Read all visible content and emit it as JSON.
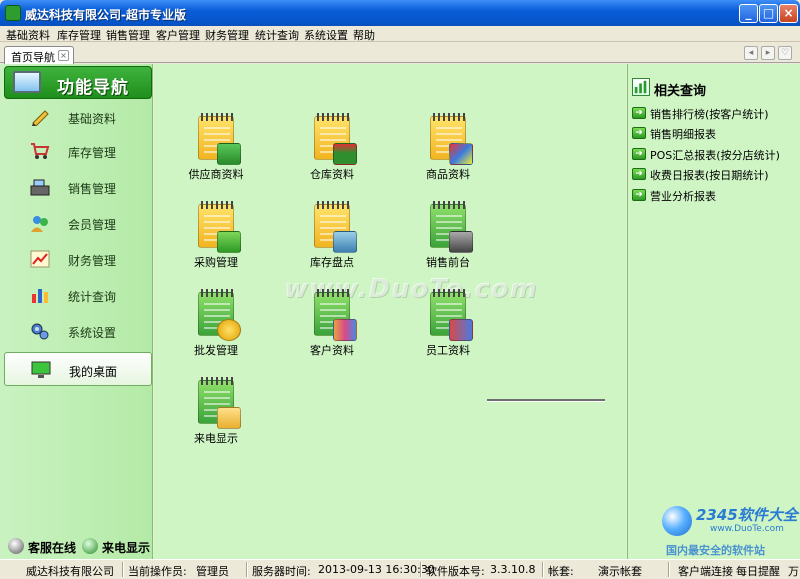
{
  "window": {
    "title": "威达科技有限公司-超市专业版"
  },
  "menu": [
    "基础资料",
    "库存管理",
    "销售管理",
    "客户管理",
    "财务管理",
    "统计查询",
    "系统设置",
    "帮助"
  ],
  "tab": {
    "label": "首页导航"
  },
  "sidebar": {
    "header": "功能导航",
    "items": [
      {
        "label": "基础资料",
        "icon": "pencil-icon"
      },
      {
        "label": "库存管理",
        "icon": "cart-icon"
      },
      {
        "label": "销售管理",
        "icon": "cash-register-icon"
      },
      {
        "label": "会员管理",
        "icon": "members-icon"
      },
      {
        "label": "财务管理",
        "icon": "chart-icon"
      },
      {
        "label": "统计查询",
        "icon": "statistics-icon"
      },
      {
        "label": "系统设置",
        "icon": "gears-icon"
      },
      {
        "label": "我的桌面",
        "icon": "desktop-icon"
      }
    ],
    "bottom": {
      "service": "客服在线",
      "caller": "来电显示"
    }
  },
  "tiles": [
    {
      "label": "供应商资料",
      "icon": "truck-icon"
    },
    {
      "label": "仓库资料",
      "icon": "warehouse-icon"
    },
    {
      "label": "商品资料",
      "icon": "goods-icon"
    },
    {
      "label": "采购管理",
      "icon": "purchase-cart-icon"
    },
    {
      "label": "库存盘点",
      "icon": "calculator-icon"
    },
    {
      "label": "销售前台",
      "icon": "pos-register-icon"
    },
    {
      "label": "批发管理",
      "icon": "sale-tag-icon"
    },
    {
      "label": "客户资料",
      "icon": "customers-icon"
    },
    {
      "label": "员工资料",
      "icon": "staff-icon"
    },
    {
      "label": "来电显示",
      "icon": "phone-icon"
    }
  ],
  "watermark": "www.DuoTe.com",
  "related": {
    "title": "相关查询",
    "links": [
      "销售排行榜(按客户统计)",
      "销售明细报表",
      "POS汇总报表(按分店统计)",
      "收费日报表(按日期统计)",
      "营业分析报表"
    ]
  },
  "brand": {
    "line1": "2345软件大全",
    "line2": "www.DuoTe.com",
    "line3": "国内最安全的软件站"
  },
  "status": {
    "company": "威达科技有限公司",
    "operator_label": "当前操作员:",
    "operator": "管理员",
    "server_time_label": "服务器时间:",
    "server_time": "2013-09-13 16:30:30",
    "version_label": "软件版本号:",
    "version": "3.3.10.8",
    "account_label": "帐套:",
    "account": "演示帐套",
    "client_status": "客户端连接",
    "daily": "每日提醒",
    "more": "万"
  }
}
